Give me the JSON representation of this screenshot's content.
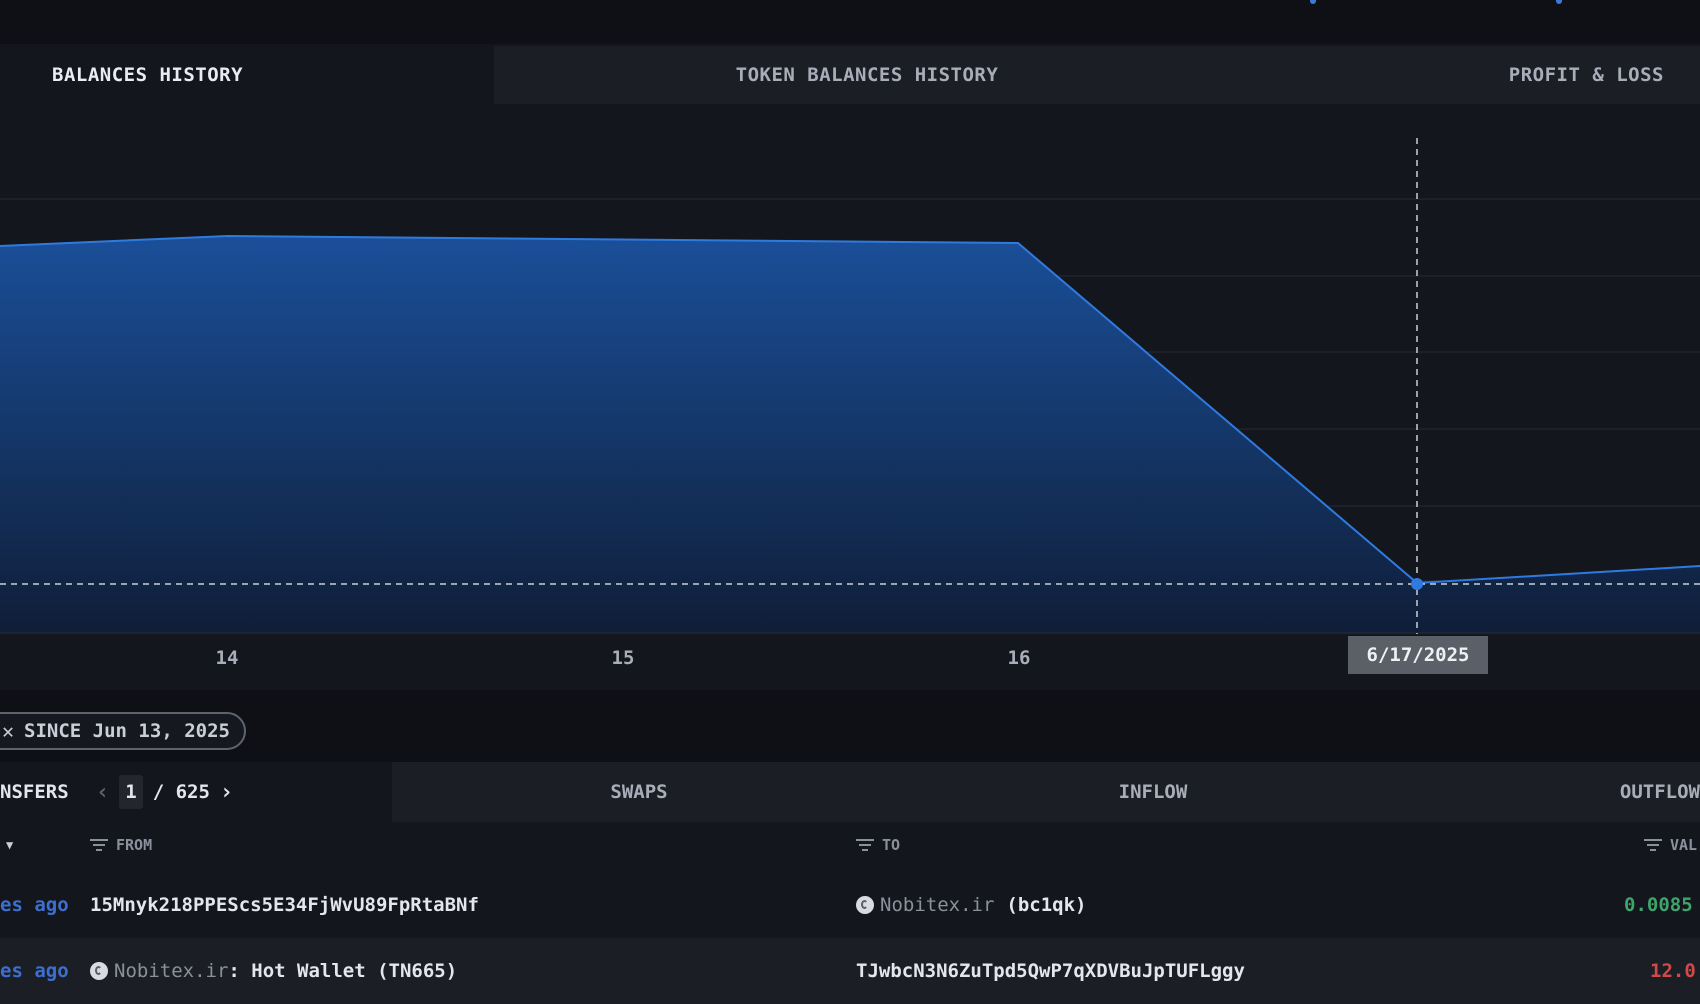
{
  "top_tabs": [
    {
      "label": "BALANCES HISTORY",
      "active": true
    },
    {
      "label": "TOKEN BALANCES HISTORY",
      "active": false
    },
    {
      "label": "PROFIT & LOSS",
      "active": false
    }
  ],
  "chart_data": {
    "type": "area",
    "x_ticks": [
      "14",
      "15",
      "16"
    ],
    "hover_label": "6/17/2025",
    "colors": {
      "area": "#1a4f99",
      "line": "#2f7ae0",
      "crosshair": "#c9ced8"
    },
    "grid": true
  },
  "filter": {
    "label": "SINCE Jun 13, 2025",
    "close_icon": "close-icon"
  },
  "bottom_tabs": {
    "transfers": {
      "label": "NSFERS",
      "page_current": "1",
      "page_sep": "/ 625"
    },
    "swaps": "SWAPS",
    "inflow": "INFLOW",
    "outflow": "OUTFLOW"
  },
  "table": {
    "headers": {
      "from": "FROM",
      "to": "TO",
      "value": "VAL"
    },
    "rows": [
      {
        "time": "es ago",
        "from": "15Mnyk218PPEScs5E34FjWvU89FpRtaBNf",
        "to_entity": "Nobitex.ir",
        "to_suffix": "(bc1qk)",
        "value": "0.0085"
      },
      {
        "time": "es ago",
        "from_entity": "Nobitex.ir",
        "from_suffix": ": Hot Wallet (TN665)",
        "to": "TJwbcN3N6ZuTpd5QwP7qXDVBuJpTUFLggy",
        "value": "12.0"
      }
    ]
  }
}
